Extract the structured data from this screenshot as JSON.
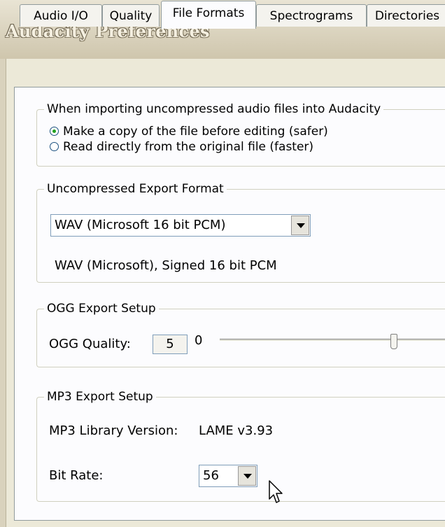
{
  "window": {
    "title": "Audacity Preferences"
  },
  "tabs": [
    {
      "label": "Audio I/O",
      "active": false
    },
    {
      "label": "Quality",
      "active": false
    },
    {
      "label": "File Formats",
      "active": true
    },
    {
      "label": "Spectrograms",
      "active": false
    },
    {
      "label": "Directories",
      "active": false
    }
  ],
  "import_group": {
    "title": "When importing uncompressed audio files into Audacity",
    "options": [
      {
        "label": "Make a copy of the file before editing (safer)",
        "checked": true
      },
      {
        "label": "Read directly from the original file (faster)",
        "checked": false
      }
    ]
  },
  "export_group": {
    "title": "Uncompressed Export Format",
    "format_value": "WAV (Microsoft 16 bit PCM)",
    "format_description": "WAV (Microsoft), Signed 16 bit PCM"
  },
  "ogg_group": {
    "title": "OGG Export Setup",
    "quality_label": "OGG Quality:",
    "quality_value": "5",
    "min_label": "0",
    "slider_fraction": 0.5
  },
  "mp3_group": {
    "title": "MP3 Export Setup",
    "library_label": "MP3 Library Version:",
    "library_value": "LAME v3.93",
    "bitrate_label": "Bit Rate:",
    "bitrate_value": "56"
  },
  "colors": {
    "titlebar_text": "#f4efe0",
    "panel": "#fcfcfe",
    "radio_dot": "#21a121"
  }
}
